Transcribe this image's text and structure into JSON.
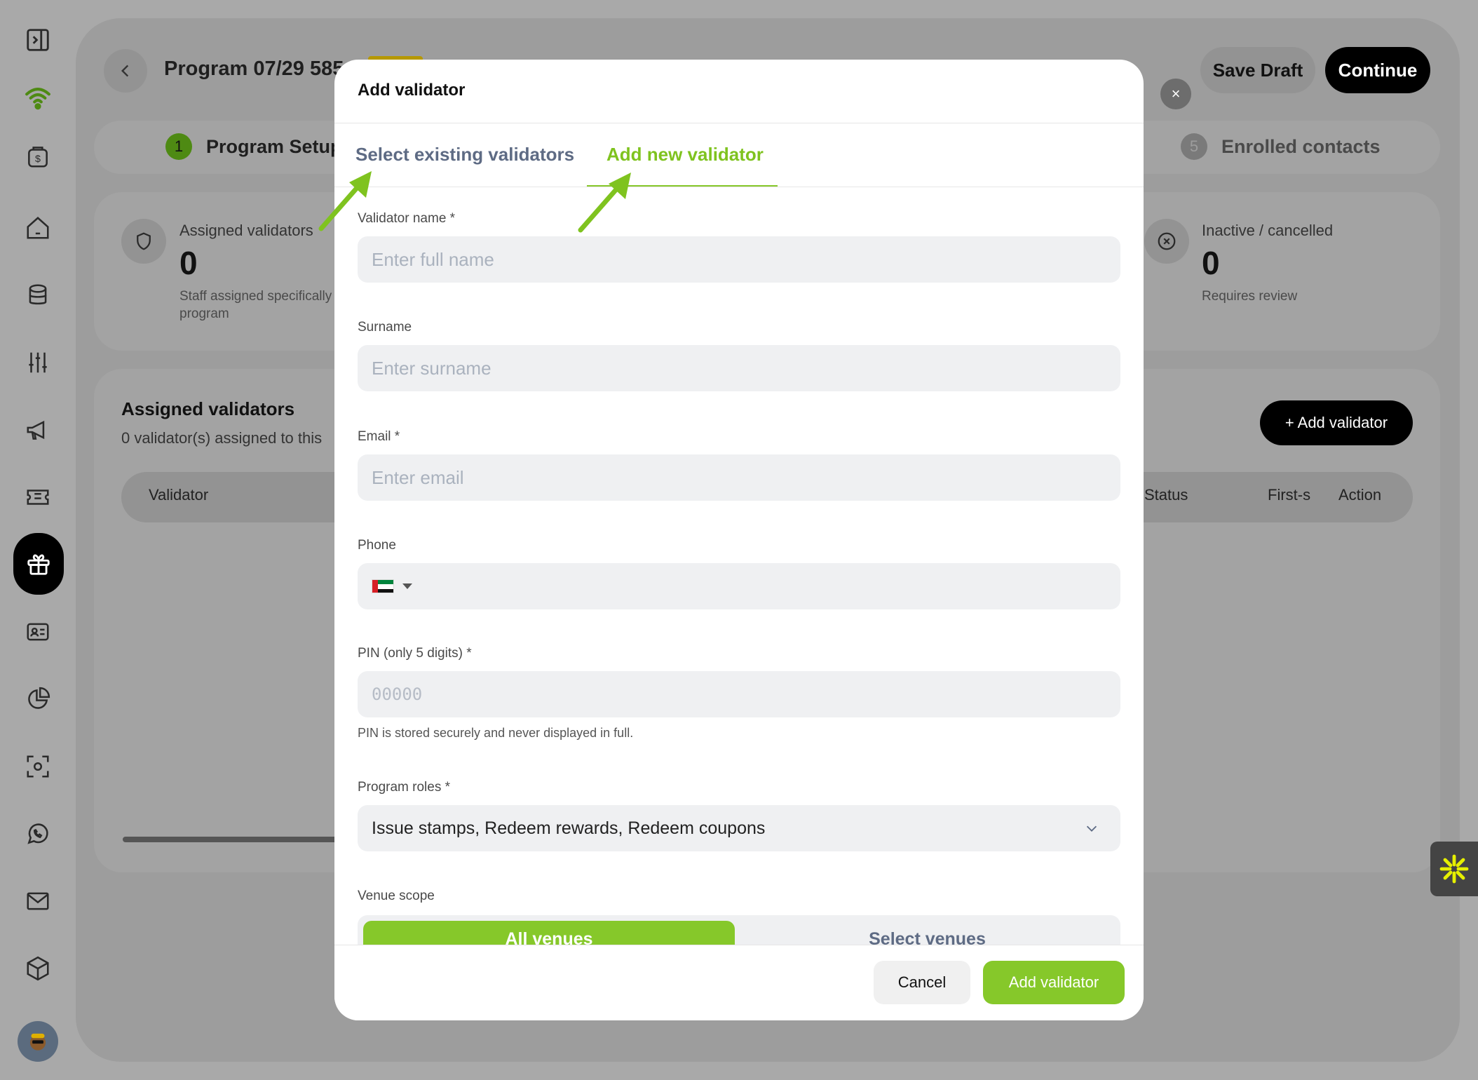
{
  "header": {
    "title": "Program 07/29 585",
    "save_draft": "Save Draft",
    "continue": "Continue",
    "close": "×"
  },
  "steps": {
    "step1_num": "1",
    "step1_label": "Program Setup",
    "step5_num": "5",
    "step5_label": "Enrolled contacts"
  },
  "stats": {
    "assigned_label": "Assigned validators",
    "assigned_value": "0",
    "assigned_sub": "Staff assigned specifically program",
    "inactive_label": "Inactive / cancelled",
    "inactive_value": "0",
    "inactive_sub": "Requires review"
  },
  "table": {
    "title": "Assigned validators",
    "subtitle": "0 validator(s) assigned to this",
    "add_button": "+ Add validator",
    "columns": [
      "Validator",
      "Status",
      "First-s",
      "Action"
    ]
  },
  "modal": {
    "title": "Add validator",
    "tabs": [
      "Select existing validators",
      "Add new validator"
    ],
    "active_tab": "Add new validator",
    "fields": {
      "name_label": "Validator name *",
      "name_placeholder": "Enter full name",
      "surname_label": "Surname",
      "surname_placeholder": "Enter surname",
      "email_label": "Email *",
      "email_placeholder": "Enter email",
      "phone_label": "Phone",
      "pin_label": "PIN (only 5 digits) *",
      "pin_placeholder": "00000",
      "pin_hint": "PIN is stored securely and never displayed in full.",
      "roles_label": "Program roles *",
      "roles_value": "Issue stamps, Redeem rewards, Redeem coupons",
      "venue_label": "Venue scope",
      "venue_options": [
        "All venues",
        "Select venues"
      ]
    },
    "cancel": "Cancel",
    "submit": "Add validator"
  },
  "colors": {
    "accent": "#86c82a",
    "tab_inactive": "#5e6b84",
    "overlay": "#a9a9a9"
  }
}
